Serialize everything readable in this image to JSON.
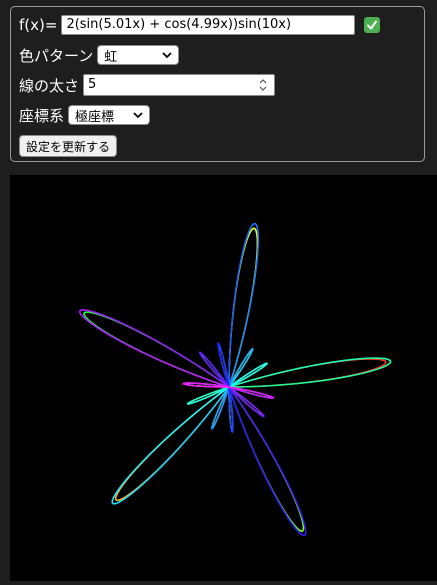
{
  "settings": {
    "function_label": "f(x)=",
    "function_value": "2(sin(5.01x) + cos(4.99x))sin(10x)",
    "valid_icon": "check-mark-icon",
    "color_pattern_label": "色パターン",
    "color_pattern_value": "虹",
    "line_width_label": "線の太さ",
    "line_width_value": "5",
    "coordinate_label": "座標系",
    "coordinate_value": "極座標",
    "update_button_label": "設定を更新する"
  },
  "plot": {
    "type": "polar",
    "formula": "2(sin(5.01x) + cos(4.99x))sin(10x)",
    "color_scheme": "rainbow",
    "background": "#000000",
    "theta_range": [
      0,
      6.2832
    ]
  },
  "colors": {
    "accent_check": "#4caf50",
    "panel_border": "#9a9a9a",
    "page_background": "#1e1e1e"
  }
}
